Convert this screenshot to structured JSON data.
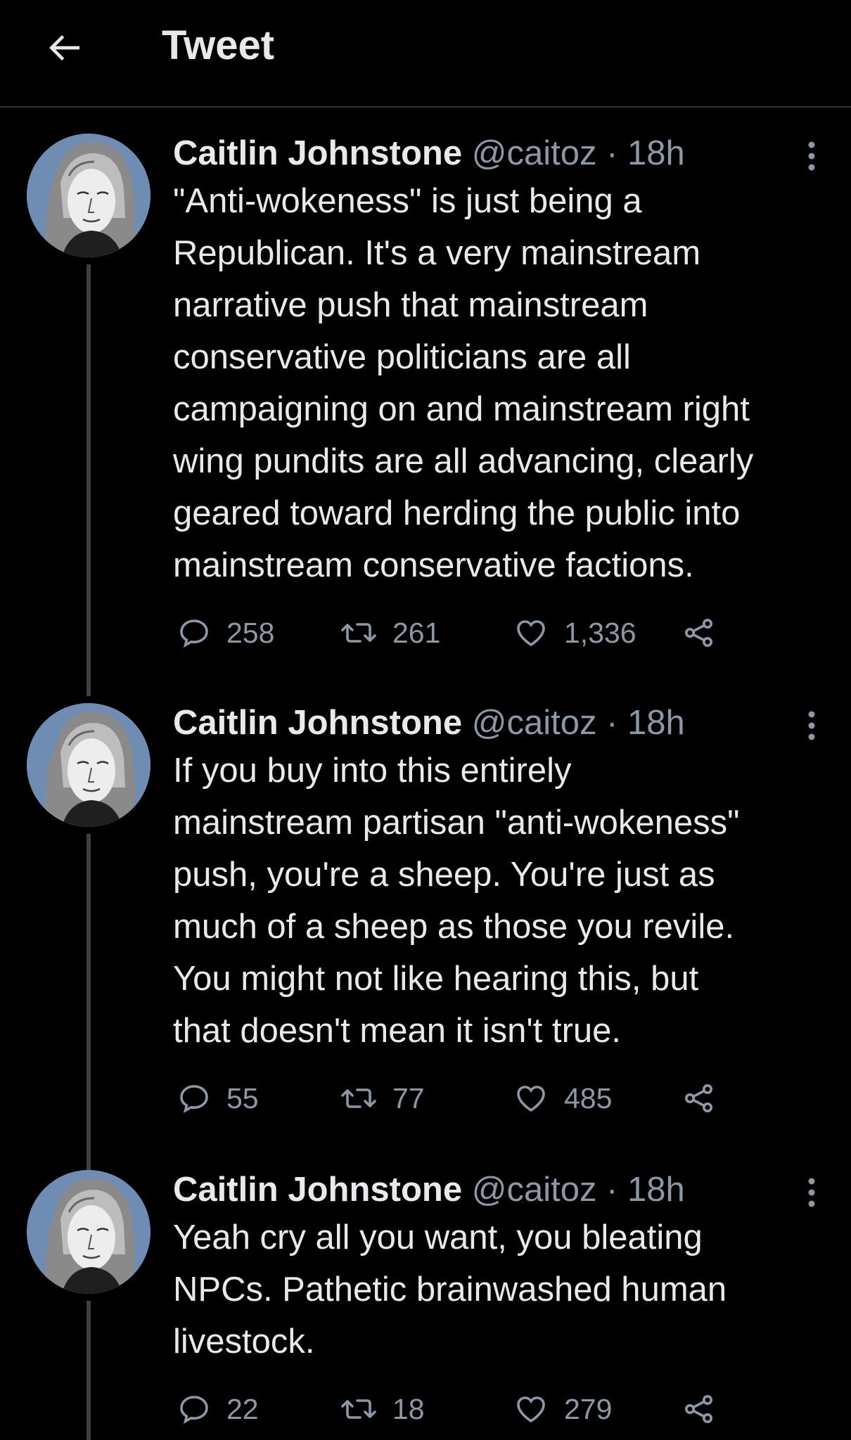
{
  "header": {
    "title": "Tweet",
    "back_icon": "arrow-left-icon"
  },
  "colors": {
    "background": "#000000",
    "text": "#e7e9ea",
    "muted": "#8b98a5",
    "divider": "#2f3336"
  },
  "tweets": [
    {
      "name": "Caitlin Johnstone",
      "handle": "@caitoz",
      "time": "· 18h",
      "text": "\"Anti-wokeness\" is just being a\nRepublican. It's a very mainstream\nnarrative push that mainstream\nconservative politicians are all\ncampaigning on and mainstream right\nwing pundits are all advancing, clearly\ngeared toward herding the public into\nmainstream conservative factions.",
      "replies": "258",
      "retweets": "261",
      "likes": "1,336"
    },
    {
      "name": "Caitlin Johnstone",
      "handle": "@caitoz",
      "time": "· 18h",
      "text": "If you buy into this entirely\nmainstream partisan \"anti-wokeness\"\npush, you're a sheep. You're just as\nmuch of a sheep as those you revile.\nYou might not like hearing this, but\nthat doesn't mean it isn't true.",
      "replies": "55",
      "retweets": "77",
      "likes": "485"
    },
    {
      "name": "Caitlin Johnstone",
      "handle": "@caitoz",
      "time": "· 18h",
      "text": "Yeah cry all you want, you bleating\nNPCs. Pathetic brainwashed human\nlivestock.",
      "replies": "22",
      "retweets": "18",
      "likes": "279"
    }
  ]
}
